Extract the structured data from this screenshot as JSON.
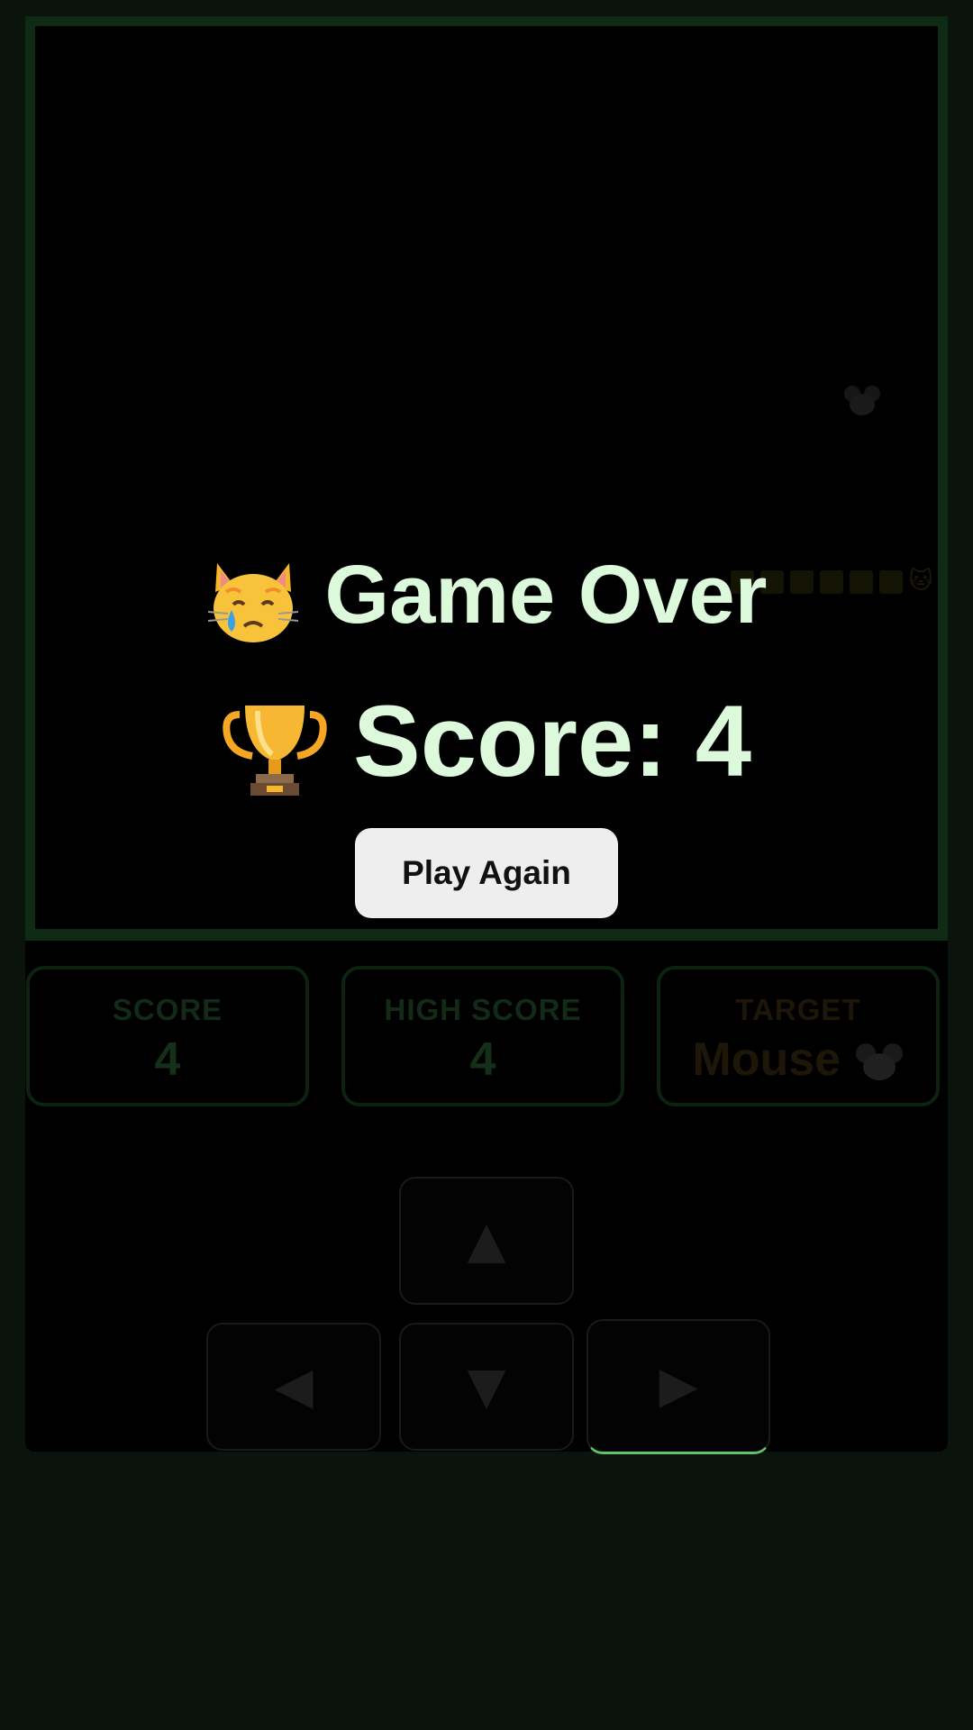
{
  "overlay": {
    "title": "Game Over",
    "title_icon": "crying-cat-face-icon",
    "score_text": "Score: 4",
    "score_icon": "trophy-icon",
    "play_again_label": "Play Again"
  },
  "stats": {
    "score_label": "SCORE",
    "score_value": "4",
    "high_score_label": "HIGH SCORE",
    "high_score_value": "4",
    "target_label": "TARGET",
    "target_value": "Mouse",
    "target_icon": "mouse-face-icon"
  },
  "controls": {
    "up": "▲",
    "down": "▼",
    "left": "◀",
    "right": "▶"
  },
  "board": {
    "snake_head_icon": "cat-face-icon",
    "snake_length": 6,
    "food_icon": "mouse-face-icon"
  },
  "colors": {
    "background": "#0a130c",
    "accent": "#7de08a",
    "overlay_text": "#dcf9dc",
    "button_bg": "#eeeeee"
  }
}
